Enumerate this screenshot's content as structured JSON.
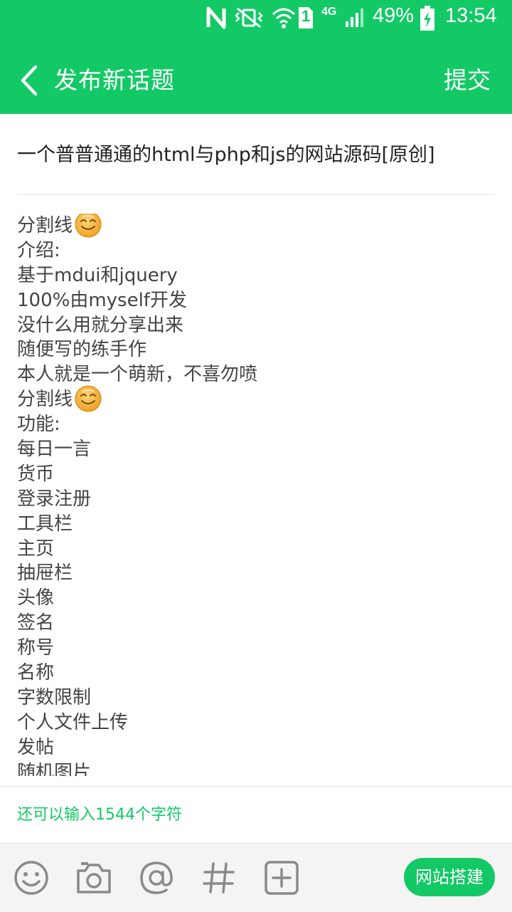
{
  "status_bar": {
    "signal_type": "4G",
    "sim_slot": "1",
    "battery": "49%",
    "time": "13:54",
    "icons": [
      "nfc-icon",
      "vibrate-icon",
      "wifi-icon",
      "sim-icon",
      "signal-icon",
      "battery-charging-icon"
    ]
  },
  "header": {
    "back_icon": "chevron-left-icon",
    "title": "发布新话题",
    "submit_label": "提交"
  },
  "post": {
    "title": "一个普普通通的html与php和js的网站源码[原创]",
    "content_lines": [
      {
        "text": "分割线",
        "emoji": true
      },
      {
        "text": "介绍:",
        "emoji": false
      },
      {
        "text": "基于mdui和jquery",
        "emoji": false
      },
      {
        "text": "100%由myself开发",
        "emoji": false
      },
      {
        "text": "没什么用就分享出来",
        "emoji": false
      },
      {
        "text": "随便写的练手作",
        "emoji": false
      },
      {
        "text": "本人就是一个萌新，不喜勿喷",
        "emoji": false
      },
      {
        "text": "分割线",
        "emoji": true
      },
      {
        "text": "功能:",
        "emoji": false
      },
      {
        "text": "每日一言",
        "emoji": false
      },
      {
        "text": "货币",
        "emoji": false
      },
      {
        "text": "登录注册",
        "emoji": false
      },
      {
        "text": "工具栏",
        "emoji": false
      },
      {
        "text": "主页",
        "emoji": false
      },
      {
        "text": "抽屉栏",
        "emoji": false
      },
      {
        "text": "头像",
        "emoji": false
      },
      {
        "text": "签名",
        "emoji": false
      },
      {
        "text": "称号",
        "emoji": false
      },
      {
        "text": "名称",
        "emoji": false
      },
      {
        "text": "字数限制",
        "emoji": false
      },
      {
        "text": "个人文件上传",
        "emoji": false
      },
      {
        "text": "发帖",
        "emoji": false
      },
      {
        "text": "随机图片",
        "emoji": false
      }
    ]
  },
  "counter": {
    "text": "还可以输入1544个字符"
  },
  "toolbar": {
    "icons": [
      "emoji-icon",
      "camera-icon",
      "at-icon",
      "hashtag-icon",
      "add-icon"
    ],
    "tag_label": "网站搭建"
  },
  "colors": {
    "accent": "#13c966",
    "text": "#444444",
    "toolbar_icon": "#8a8a8a"
  }
}
